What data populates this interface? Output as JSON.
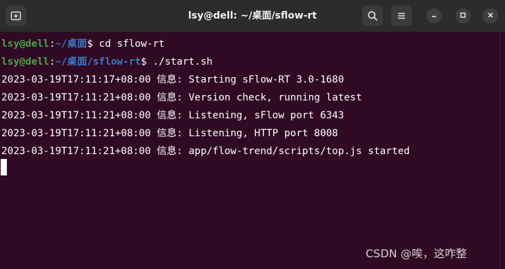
{
  "window": {
    "title": "lsy@dell: ~/桌面/sflow-rt"
  },
  "titlebar": {
    "new_tab_icon": "new-tab-icon",
    "search_icon": "search-icon",
    "menu_icon": "hamburger-menu-icon",
    "minimize_icon": "minimize-icon",
    "maximize_icon": "maximize-icon",
    "close_icon": "close-icon"
  },
  "colors": {
    "terminal_bg": "#300a24",
    "titlebar_bg": "#2c2c2c",
    "prompt_user": "#4ea04b",
    "prompt_path": "#3b78c4",
    "text": "#ffffff"
  },
  "terminal": {
    "lines": [
      {
        "user": "lsy@dell",
        "colon": ":",
        "path": "~/桌面",
        "command": "$ cd sflow-rt"
      },
      {
        "user": "lsy@dell",
        "colon": ":",
        "path": "~/桌面/sflow-rt",
        "command": "$ ./start.sh"
      },
      {
        "text": "2023-03-19T17:11:17+08:00 信息: Starting sFlow-RT 3.0-1680"
      },
      {
        "text": "2023-03-19T17:11:21+08:00 信息: Version check, running latest"
      },
      {
        "text": "2023-03-19T17:11:21+08:00 信息: Listening, sFlow port 6343"
      },
      {
        "text": "2023-03-19T17:11:21+08:00 信息: Listening, HTTP port 8008"
      },
      {
        "text": "2023-03-19T17:11:21+08:00 信息: app/flow-trend/scripts/top.js started"
      }
    ]
  },
  "watermark": {
    "text": "CSDN @唉，这咋整"
  }
}
